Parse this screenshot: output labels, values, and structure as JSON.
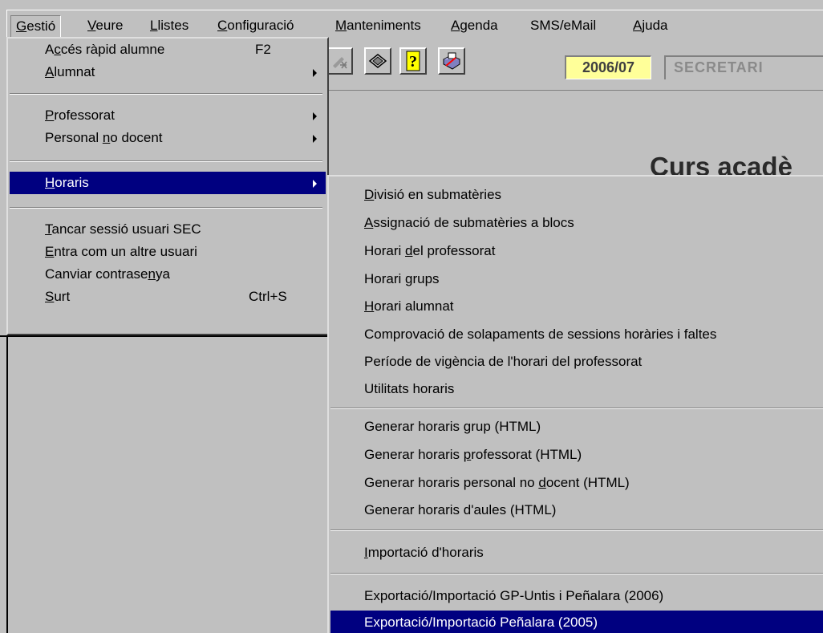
{
  "menubar": [
    {
      "u": "G",
      "rest": "estió"
    },
    {
      "u": "V",
      "rest": "eure"
    },
    {
      "u": "L",
      "rest": "listes"
    },
    {
      "u": "C",
      "rest": "onfiguració"
    },
    {
      "u": "M",
      "rest": "anteniments"
    },
    {
      "u": "A",
      "rest": "genda"
    },
    {
      "plain": "SMS/eMail"
    },
    {
      "u": "A",
      "rest": "juda"
    }
  ],
  "toolbar": {
    "year": "2006/07",
    "user": "SECRETARI"
  },
  "content": {
    "title": "Curs acadè"
  },
  "gestio_menu": [
    {
      "pre": "A",
      "u": "c",
      "post": "cés ràpid alumne",
      "shortcut": "F2"
    },
    {
      "pre": "",
      "u": "A",
      "post": "lumnat",
      "submenu": true
    },
    {
      "pre": "",
      "u": "P",
      "post": "rofessorat",
      "submenu": true
    },
    {
      "pre": "Personal ",
      "u": "n",
      "post": "o docent",
      "submenu": true
    },
    {
      "pre": "",
      "u": "H",
      "post": "oraris",
      "submenu": true,
      "selected": true
    },
    {
      "pre": "",
      "u": "T",
      "post": "ancar sessió usuari SEC"
    },
    {
      "pre": "",
      "u": "E",
      "post": "ntra com un altre usuari"
    },
    {
      "pre": "Canviar contrase",
      "u": "n",
      "post": "ya"
    },
    {
      "pre": "",
      "u": "S",
      "post": "urt",
      "shortcut": "Ctrl+S"
    }
  ],
  "horaris_menu": [
    {
      "pre": "",
      "u": "D",
      "post": "ivisió en submatèries"
    },
    {
      "pre": "",
      "u": "A",
      "post": "ssignació de submatèries a blocs"
    },
    {
      "pre": "Horari ",
      "u": "d",
      "post": "el professorat"
    },
    {
      "pre": "Horari ",
      "u": "g",
      "post": "rups"
    },
    {
      "pre": "",
      "u": "H",
      "post": "orari alumnat"
    },
    {
      "pre": "Comprovació de solapaments de sessions horàries i faltes",
      "u": "",
      "post": ""
    },
    {
      "pre": "Període de vigència de l'horari del professorat",
      "u": "",
      "post": ""
    },
    {
      "pre": "Utilitats horaris",
      "u": "",
      "post": ""
    },
    {
      "pre": "Generar horaris ",
      "u": "g",
      "post": "rup (HTML)"
    },
    {
      "pre": "Generar horaris ",
      "u": "p",
      "post": "rofessorat (HTML)"
    },
    {
      "pre": "Generar horaris personal no ",
      "u": "d",
      "post": "ocent (HTML)"
    },
    {
      "pre": "Generar horaris d'aules (HTML)",
      "u": "",
      "post": ""
    },
    {
      "pre": "",
      "u": "I",
      "post": "mportació d'horaris"
    },
    {
      "pre": "Exportació/Importació GP-Untis i Peñalara (2006)",
      "u": "",
      "post": ""
    },
    {
      "pre": "Exportació/Importació Peñalara (2005)",
      "u": "",
      "post": "",
      "selected": true
    }
  ]
}
